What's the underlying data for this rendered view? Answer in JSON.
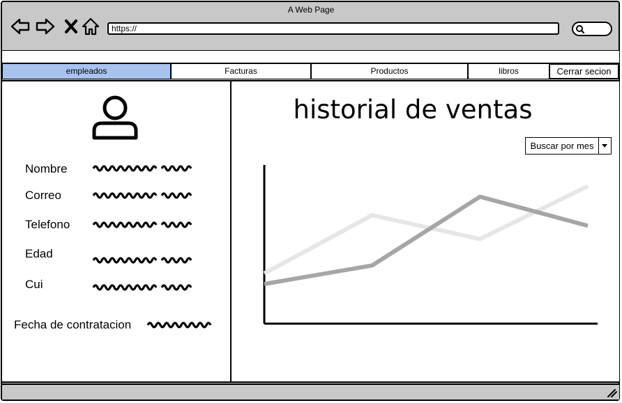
{
  "window": {
    "title": "A Web Page"
  },
  "browser": {
    "url": "https://"
  },
  "nav": {
    "tabs": [
      {
        "label": "empleados",
        "active": true
      },
      {
        "label": "Facturas",
        "active": false
      },
      {
        "label": "Productos",
        "active": false
      },
      {
        "label": "libros",
        "active": false
      }
    ],
    "logout_label": "Cerrar secion"
  },
  "profile": {
    "fields": [
      {
        "label": "Nombre"
      },
      {
        "label": "Correo"
      },
      {
        "label": "Telefono"
      },
      {
        "label": "Edad"
      },
      {
        "label": "Cui"
      }
    ],
    "hire_date_label": "Fecha de contratacion"
  },
  "sales": {
    "title": "historial de ventas",
    "filter_label": "Buscar por mes"
  },
  "colors": {
    "active_tab": "#a9c3ef",
    "chrome": "#c8c8c8",
    "series_dark": "#a6a6a6",
    "series_light": "#e6e6e6"
  },
  "chart_data": {
    "type": "line",
    "x": [
      0,
      1,
      2,
      3
    ],
    "series": [
      {
        "values": [
          0.95,
          2.05,
          1.6,
          2.6
        ]
      },
      {
        "values": [
          0.75,
          1.1,
          2.4,
          1.85
        ]
      }
    ],
    "xlim": [
      0,
      3
    ],
    "ylim": [
      0,
      3
    ],
    "grid": false,
    "legend": "none",
    "xlabel": "",
    "ylabel": ""
  }
}
